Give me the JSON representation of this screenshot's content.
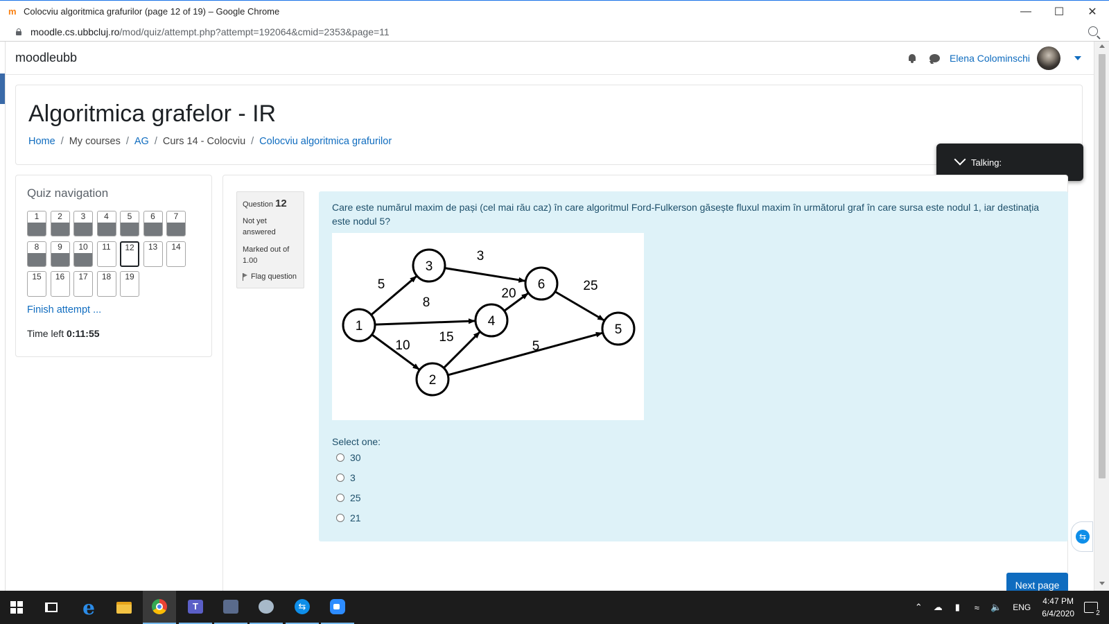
{
  "browser": {
    "window_title": "Colocviu algoritmica grafurilor (page 12 of 19) – Google Chrome",
    "favicon": "moodle-icon",
    "url_host": "moodle.cs.ubbcluj.ro",
    "url_path": "/mod/quiz/attempt.php?attempt=192064&cmid=2353&page=11",
    "controls": [
      "minimize-icon",
      "maximize-icon",
      "close-icon"
    ]
  },
  "navbar": {
    "brand": "moodleubb",
    "user_name": "Elena Colominschi"
  },
  "header": {
    "course_title": "Algoritmica grafelor - IR",
    "breadcrumb": {
      "home": "Home",
      "my_courses": "My courses",
      "ag": "AG",
      "section": "Curs 14 - Colocviu",
      "quiz": "Colocviu algoritmica grafurilor"
    }
  },
  "talking_popup": {
    "label": "Talking:"
  },
  "quiz_nav": {
    "title": "Quiz navigation",
    "questions": [
      {
        "n": "1",
        "state": "answered"
      },
      {
        "n": "2",
        "state": "answered"
      },
      {
        "n": "3",
        "state": "answered"
      },
      {
        "n": "4",
        "state": "answered"
      },
      {
        "n": "5",
        "state": "answered"
      },
      {
        "n": "6",
        "state": "answered"
      },
      {
        "n": "7",
        "state": "answered"
      },
      {
        "n": "8",
        "state": "answered"
      },
      {
        "n": "9",
        "state": "answered"
      },
      {
        "n": "10",
        "state": "answered"
      },
      {
        "n": "11",
        "state": "notyet"
      },
      {
        "n": "12",
        "state": "current"
      },
      {
        "n": "13",
        "state": "notyet"
      },
      {
        "n": "14",
        "state": "notyet"
      },
      {
        "n": "15",
        "state": "notyet"
      },
      {
        "n": "16",
        "state": "notyet"
      },
      {
        "n": "17",
        "state": "notyet"
      },
      {
        "n": "18",
        "state": "notyet"
      },
      {
        "n": "19",
        "state": "notyet"
      }
    ],
    "finish_label": "Finish attempt ...",
    "time_left_label": "Time left",
    "time_left_value": "0:11:55"
  },
  "question_info": {
    "question_word": "Question",
    "number": "12",
    "state": "Not yet answered",
    "marked": "Marked out of 1.00",
    "flag_label": "Flag question"
  },
  "question": {
    "text": "Care este numărul maxim de pași (cel mai rău caz) în care algoritmul Ford-Fulkerson găsește fluxul maxim în următorul graf în care sursa este nodul 1, iar destinația este nodul 5?",
    "graph": {
      "nodes": [
        "1",
        "2",
        "3",
        "4",
        "5",
        "6"
      ],
      "edges": [
        {
          "from": "1",
          "to": "3",
          "capacity": "5"
        },
        {
          "from": "1",
          "to": "4",
          "capacity": "8"
        },
        {
          "from": "1",
          "to": "2",
          "capacity": "10"
        },
        {
          "from": "3",
          "to": "6",
          "capacity": "3"
        },
        {
          "from": "4",
          "to": "6",
          "capacity": "20"
        },
        {
          "from": "2",
          "to": "4",
          "capacity": "15"
        },
        {
          "from": "6",
          "to": "5",
          "capacity": "25"
        },
        {
          "from": "2",
          "to": "5",
          "capacity": "5"
        }
      ]
    },
    "select_label": "Select one:",
    "options": [
      "30",
      "3",
      "25",
      "21"
    ]
  },
  "next_button": "Next page",
  "taskbar": {
    "apps": [
      "windows-start-icon",
      "task-view-icon",
      "edge-icon",
      "file-explorer-icon",
      "chrome-icon",
      "teams-icon",
      "outlook-icon",
      "paint-icon",
      "teamviewer-icon",
      "zoom-icon"
    ],
    "language": "ENG",
    "time": "4:47 PM",
    "date": "6/4/2020",
    "notification_count": "2"
  }
}
